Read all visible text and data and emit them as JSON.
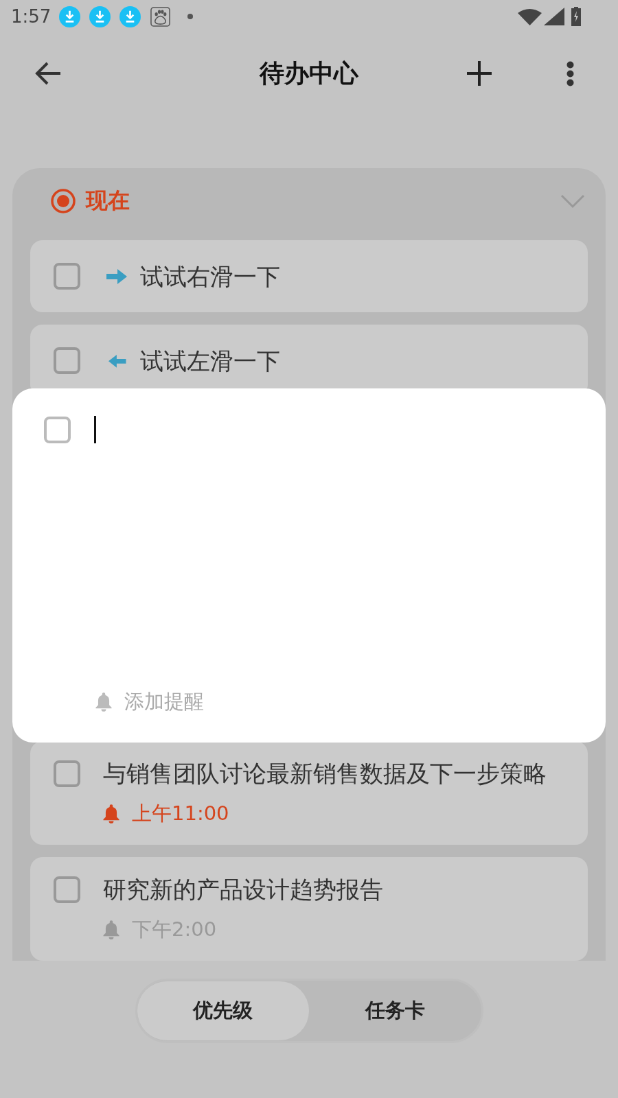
{
  "status_bar": {
    "time": "1:57"
  },
  "app_bar": {
    "title": "待办中心"
  },
  "section": {
    "title": "现在",
    "hints": [
      {
        "kind": "right",
        "title": "试试右滑一下",
        "checked": false
      },
      {
        "kind": "left",
        "title": "试试左滑一下",
        "checked": false
      }
    ],
    "tasks": [
      {
        "title": "与销售团队讨论最新销售数据及下一步策略",
        "checked": false,
        "reminder": {
          "time": "上午11:00",
          "overdue": true
        }
      },
      {
        "title": "研究新的产品设计趋势报告",
        "checked": false,
        "reminder": {
          "time": "下午2:00",
          "overdue": false
        }
      }
    ]
  },
  "new_task": {
    "checked": false,
    "focused": true,
    "reminder_button": "添加提醒"
  },
  "view_tabs": [
    {
      "label": "优先级",
      "selected": true
    },
    {
      "label": "任务卡",
      "selected": false
    }
  ]
}
